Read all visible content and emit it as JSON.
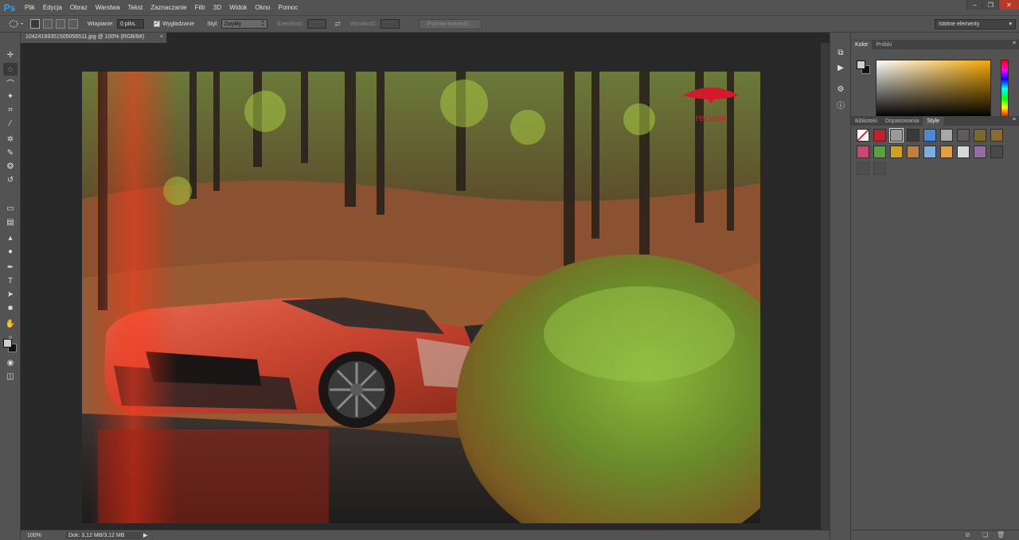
{
  "app": {
    "logo": "Ps",
    "accent_color": "#2fa3f6"
  },
  "menu": [
    "Plik",
    "Edycja",
    "Obraz",
    "Warstwa",
    "Tekst",
    "Zaznaczanie",
    "Filtr",
    "3D",
    "Widok",
    "Okno",
    "Pomoc"
  ],
  "window_controls": {
    "minimize": "–",
    "restore": "❐",
    "close": "✕"
  },
  "options": {
    "feather_label": "Wtapianie:",
    "feather_value": "0 piks.",
    "antialias_label": "Wygładzanie",
    "antialias_checked": "✓",
    "style_label": "Styl:",
    "style_value": "Zwykły",
    "width_label": "Szerokość:",
    "height_label": "Wysokość:",
    "refine_edge": "Popraw krawędź...",
    "workspace": "Istotne elementy"
  },
  "document": {
    "tab_title": "1042416935150505651​1.jpg @ 100% (RGB/8#)",
    "tab_close": "×",
    "zoom": "100%",
    "doc_info": "Dok: 3,12 MB/3,12 MB",
    "status_arrow": "▶"
  },
  "photo": {
    "brand_text": "rezvani",
    "brand_color": "#d4192a"
  },
  "panels": {
    "color_tabs": [
      "Kolor",
      "Próbki"
    ],
    "styles_tabs": [
      "Biblioteki",
      "Dopasowania",
      "Style"
    ],
    "menu_icon": "≡"
  },
  "tools": [
    {
      "name": "move-tool-icon",
      "glyph": "✛"
    },
    {
      "name": "marquee-tool-icon",
      "glyph": "◌"
    },
    {
      "name": "lasso-tool-icon",
      "glyph": "⌒"
    },
    {
      "name": "quick-select-tool-icon",
      "glyph": "✦"
    },
    {
      "name": "crop-tool-icon",
      "glyph": "⌗"
    },
    {
      "name": "eyedropper-tool-icon",
      "glyph": "⁄"
    },
    {
      "name": "healing-brush-tool-icon",
      "glyph": "✲"
    },
    {
      "name": "brush-tool-icon",
      "glyph": "✎"
    },
    {
      "name": "clone-stamp-tool-icon",
      "glyph": "❂"
    },
    {
      "name": "history-brush-tool-icon",
      "glyph": "↺"
    },
    {
      "name": "eraser-tool-icon",
      "glyph": "▭"
    },
    {
      "name": "gradient-tool-icon",
      "glyph": "▤"
    },
    {
      "name": "blur-tool-icon",
      "glyph": "▴"
    },
    {
      "name": "dodge-tool-icon",
      "glyph": "●"
    },
    {
      "name": "pen-tool-icon",
      "glyph": "✒"
    },
    {
      "name": "type-tool-icon",
      "glyph": "T"
    },
    {
      "name": "path-select-tool-icon",
      "glyph": "➤"
    },
    {
      "name": "shape-tool-icon",
      "glyph": "■"
    },
    {
      "name": "hand-tool-icon",
      "glyph": "✋"
    },
    {
      "name": "zoom-tool-icon",
      "glyph": "⌕"
    }
  ],
  "dock_icons": [
    {
      "name": "history-panel-icon",
      "glyph": "⧉"
    },
    {
      "name": "actions-panel-icon",
      "glyph": "▶"
    },
    {
      "name": "properties-panel-icon",
      "glyph": "⚙"
    },
    {
      "name": "info-panel-icon",
      "glyph": "ⓘ"
    }
  ],
  "style_swatches": [
    {
      "name": "style-none",
      "color": "#ffffff"
    },
    {
      "name": "style-red-glow",
      "color": "#c0202e"
    },
    {
      "name": "style-silver",
      "color": "#9a9a9a"
    },
    {
      "name": "style-dark-bevel",
      "color": "#3a3a3a"
    },
    {
      "name": "style-blue-bevel",
      "color": "#4a8ad8"
    },
    {
      "name": "style-gray-bevel",
      "color": "#a8a8a8"
    },
    {
      "name": "style-dark-gray",
      "color": "#5c5c5c"
    },
    {
      "name": "style-olive",
      "color": "#7a6a2a"
    },
    {
      "name": "style-bronze",
      "color": "#8a6a30"
    },
    {
      "name": "style-pink",
      "color": "#c84870"
    },
    {
      "name": "style-multicolor",
      "color": "#5aa040"
    },
    {
      "name": "style-gold",
      "color": "#d0a020"
    },
    {
      "name": "style-copper",
      "color": "#c08040"
    },
    {
      "name": "style-sky",
      "color": "#7ab0e0"
    },
    {
      "name": "style-sunset",
      "color": "#e0a040"
    },
    {
      "name": "style-chrome",
      "color": "#d8d8d8"
    },
    {
      "name": "style-violet",
      "color": "#9070a0"
    },
    {
      "name": "style-charcoal",
      "color": "#4a4a4a"
    },
    {
      "name": "style-empty-1",
      "color": "#4e4e4e"
    },
    {
      "name": "style-empty-2",
      "color": "#4e4e4e"
    }
  ]
}
